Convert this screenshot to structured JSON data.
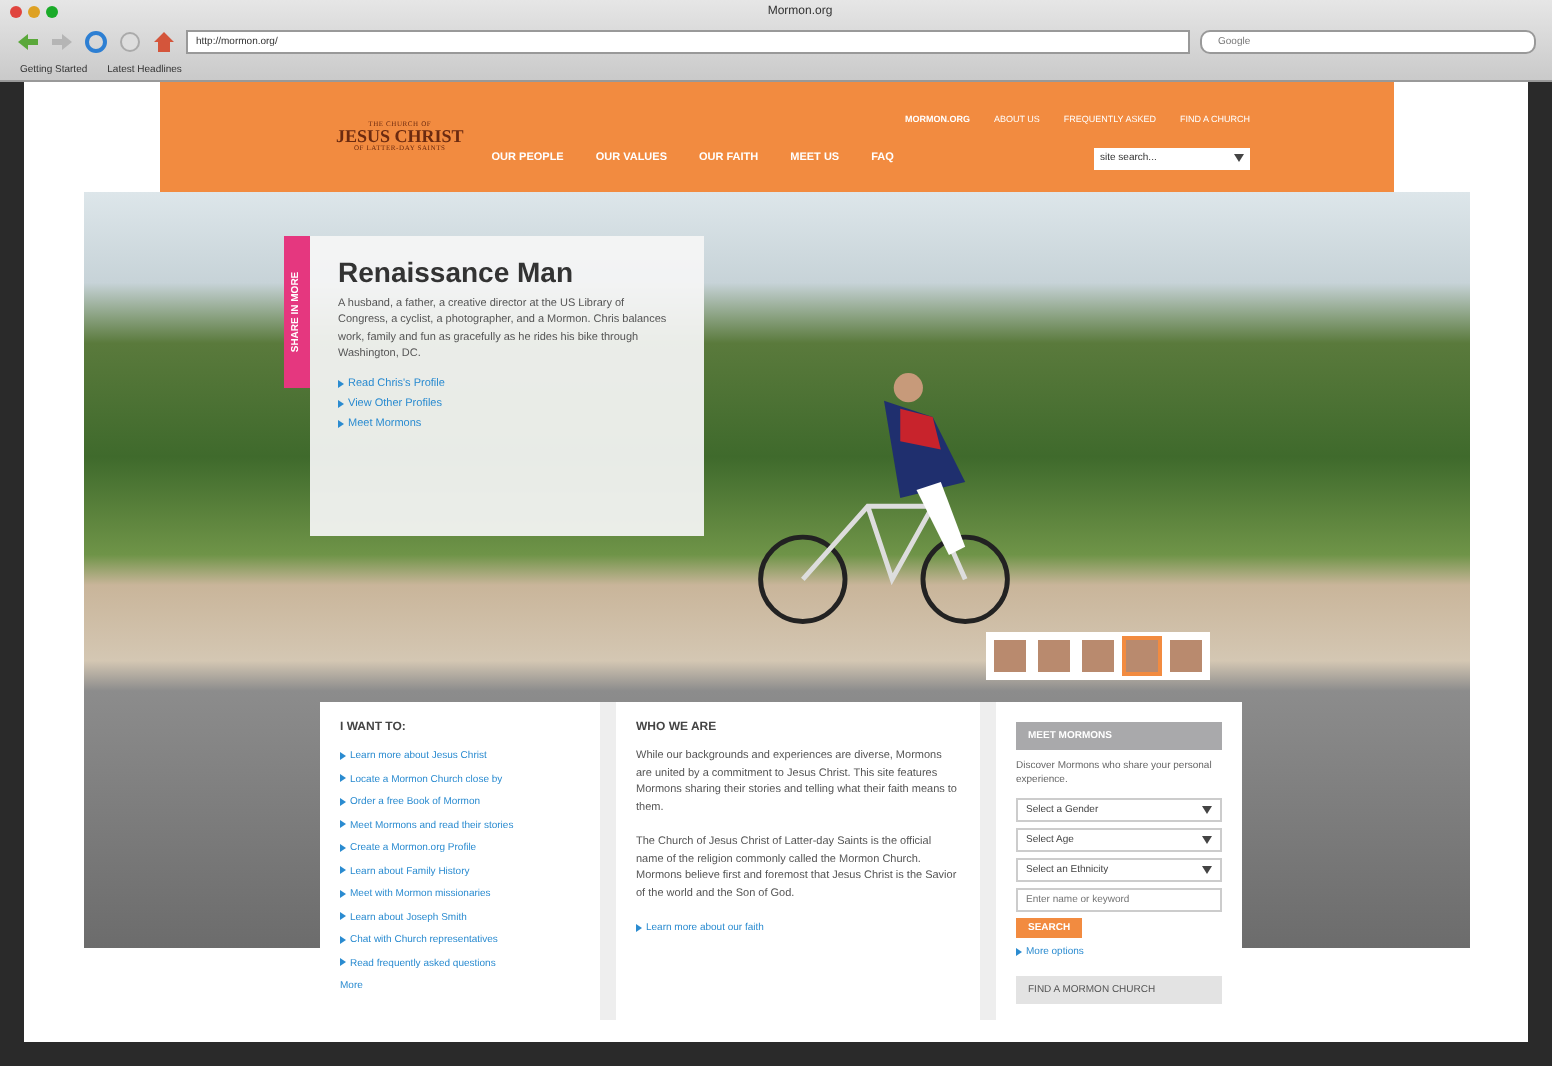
{
  "browser": {
    "title": "Mormon.org",
    "url": "http://mormon.org/",
    "search_placeholder": "Google",
    "bookmarks": [
      "Getting Started",
      "Latest Headlines"
    ]
  },
  "header": {
    "logo": {
      "line_1": "THE CHURCH OF",
      "line_2": "JESUS CHRIST",
      "line_3": "OF LATTER-DAY SAINTS"
    },
    "utility_links": [
      {
        "label": "MORMON.ORG",
        "selected": true
      },
      {
        "label": "ABOUT US",
        "selected": false
      },
      {
        "label": "FREQUENTLY ASKED",
        "selected": false
      },
      {
        "label": "FIND A CHURCH",
        "selected": false
      }
    ],
    "nav": [
      "OUR PEOPLE",
      "OUR VALUES",
      "OUR FAITH",
      "MEET US",
      "FAQ"
    ],
    "search": {
      "placeholder": "site search..."
    }
  },
  "hero": {
    "side_tab": "SHARE IN MORE",
    "title": "Renaissance Man",
    "body": "A husband, a father, a creative director at the US Library of Congress, a cyclist, a photographer, and a Mormon. Chris balances work, family and fun as gracefully as he rides his bike through Washington, DC.",
    "links": [
      "Read Chris's Profile",
      "View Other Profiles",
      "Meet Mormons"
    ],
    "thumbnails": [
      {
        "selected": false
      },
      {
        "selected": false
      },
      {
        "selected": false
      },
      {
        "selected": true
      },
      {
        "selected": false
      }
    ]
  },
  "i_want_to": {
    "title": "I WANT TO:",
    "links": [
      "Learn more about Jesus Christ",
      "Locate a Mormon Church close by",
      "Order a free Book of Mormon",
      "Meet Mormons and read their stories",
      "Create a Mormon.org Profile",
      "Learn about Family History",
      "Meet with Mormon missionaries",
      "Learn about Joseph Smith",
      "Chat with Church representatives",
      "Read frequently asked questions"
    ],
    "more": "More"
  },
  "who_we_are": {
    "title": "WHO WE ARE",
    "paragraphs": [
      "While our backgrounds and experiences are diverse, Mormons are united by a commitment to Jesus Christ. This site features Mormons sharing their stories and telling what their faith means to them.",
      "The Church of Jesus Christ of Latter-day Saints is the official name of the religion commonly called the Mormon Church. Mormons believe first and foremost that Jesus Christ is the Savior of the world and the Son of God."
    ],
    "link": "Learn more about our faith"
  },
  "meet_mormons": {
    "title": "MEET MORMONS",
    "intro": "Discover Mormons who share your personal experience.",
    "selects": [
      "Select a Gender",
      "Select Age",
      "Select an Ethnicity"
    ],
    "input": {
      "placeholder": "Enter name or keyword"
    },
    "button": "SEARCH",
    "link": "More options",
    "footer_bar": "FIND A MORMON CHURCH"
  }
}
